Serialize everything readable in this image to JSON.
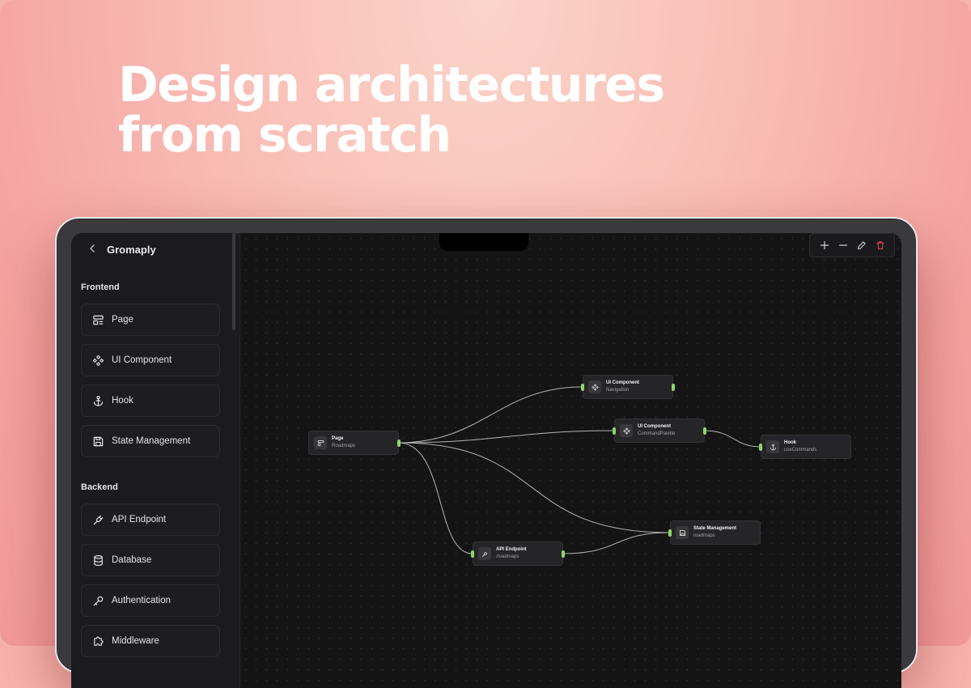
{
  "headline": [
    "Design architectures",
    "from scratch"
  ],
  "app": {
    "title": "Gromaply",
    "back_icon": "chevron-left-icon"
  },
  "sidebar": {
    "sections": [
      {
        "title": "Frontend",
        "items": [
          {
            "label": "Page",
            "icon": "layout-icon"
          },
          {
            "label": "UI Component",
            "icon": "component-icon"
          },
          {
            "label": "Hook",
            "icon": "anchor-icon"
          },
          {
            "label": "State Management",
            "icon": "save-icon"
          }
        ]
      },
      {
        "title": "Backend",
        "items": [
          {
            "label": "API Endpoint",
            "icon": "plug-icon"
          },
          {
            "label": "Database",
            "icon": "database-icon"
          },
          {
            "label": "Authentication",
            "icon": "key-icon"
          },
          {
            "label": "Middleware",
            "icon": "puzzle-icon"
          }
        ]
      }
    ]
  },
  "toolbar": {
    "buttons": [
      "plus-icon",
      "minus-icon",
      "pencil-icon",
      "trash-icon"
    ],
    "danger_color": "#e5484d"
  },
  "nodes": {
    "page": {
      "title": "Page",
      "subtitle": "Roadmaps"
    },
    "ui_nav": {
      "title": "UI Component",
      "subtitle": "Navigation"
    },
    "ui_cmd": {
      "title": "UI Component",
      "subtitle": "CommandPalette"
    },
    "hook": {
      "title": "Hook",
      "subtitle": "useCommands"
    },
    "state": {
      "title": "State Management",
      "subtitle": "roadmaps"
    },
    "api": {
      "title": "API Endpoint",
      "subtitle": "/roadmaps"
    }
  },
  "colors": {
    "accent_handle": "#8fd46b",
    "canvas": "#141414",
    "edge": "#cfcfcf"
  }
}
